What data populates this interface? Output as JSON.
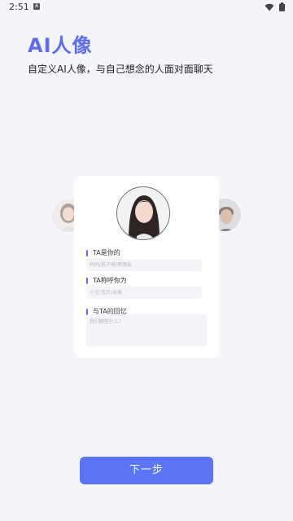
{
  "status_bar": {
    "time": "2:51",
    "app_icon_letter": "A"
  },
  "header": {
    "title": "AI人像",
    "subtitle": "自定义AI人像，与自己想念的人面对面聊天"
  },
  "form": {
    "relation": {
      "label": "TA是你的",
      "placeholder": "妈妈/孩子爸/男朋友"
    },
    "nickname": {
      "label": "TA称呼你为",
      "placeholder": "小宝/宝贝/亲爱"
    },
    "talk": {
      "label": "与TA的回忆",
      "placeholder": "我们聊些什么?"
    }
  },
  "actions": {
    "next_label": "下一步"
  },
  "colors": {
    "accent": "#5b6cf0",
    "button": "#5b75f5",
    "background": "#f4f5fa"
  }
}
